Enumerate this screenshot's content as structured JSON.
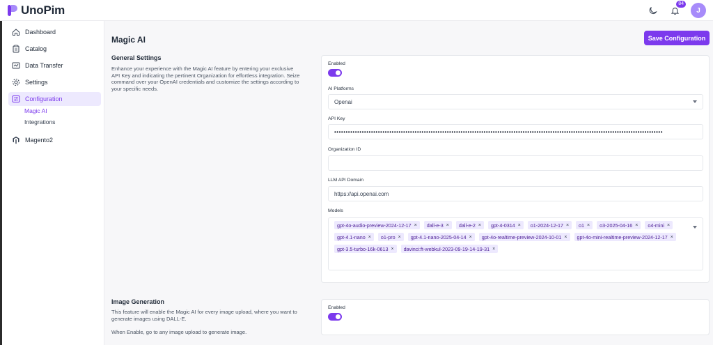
{
  "app": {
    "name": "UnoPim",
    "notifications_count": "84",
    "avatar_initial": "J",
    "accent_color": "#7c3aed"
  },
  "sidebar": {
    "items": [
      {
        "label": "Dashboard",
        "icon": "home-icon"
      },
      {
        "label": "Catalog",
        "icon": "clipboard-icon"
      },
      {
        "label": "Data Transfer",
        "icon": "data-transfer-icon"
      },
      {
        "label": "Settings",
        "icon": "gear-icon"
      },
      {
        "label": "Configuration",
        "icon": "sliders-icon"
      },
      {
        "label": "Magento2",
        "icon": "magento-icon"
      }
    ],
    "sub_items": [
      {
        "label": "Magic AI"
      },
      {
        "label": "Integrations"
      }
    ]
  },
  "page": {
    "title": "Magic AI",
    "save_label": "Save Configuration"
  },
  "general": {
    "title": "General Settings",
    "description": "Enhance your experience with the Magic AI feature by entering your exclusive API Key and indicating the pertinent Organization for effortless integration. Seize command over your OpenAI credentials and customize the settings according to your specific needs.",
    "enabled_label": "Enabled",
    "enabled": true,
    "platforms_label": "AI Platforms",
    "platform_value": "Openai",
    "api_key_label": "API Key",
    "api_key_value": "•••••••••••••••••••••••••••••••••••••••••••••••••••••••••••••••••••••••••••••••••••••••••••••••••••••••••••••••••••••••••••••••••••••••••••••••",
    "org_label": "Organization ID",
    "org_value": "",
    "domain_label": "LLM API Domain",
    "domain_value": "https://api.openai.com",
    "models_label": "Models",
    "models": [
      "gpt-4o-audio-preview-2024-12-17",
      "dall-e-3",
      "dall-e-2",
      "gpt-4-0314",
      "o1-2024-12-17",
      "o1",
      "o3-2025-04-16",
      "o4-mini",
      "gpt-4.1-nano",
      "o1-pro",
      "gpt-4.1-nano-2025-04-14",
      "gpt-4o-realtime-preview-2024-10-01",
      "gpt-4o-mini-realtime-preview-2024-12-17",
      "gpt-3.5-turbo-16k-0613",
      "davinci:ft-webkul-2023-09-19-14-19-31"
    ]
  },
  "image_generation": {
    "title": "Image Generation",
    "description": "This feature will enable the Magic AI for every image upload, where you want to generate images using DALL-E.",
    "note": "When Enable, go to any image upload to generate image.",
    "enabled_label": "Enabled",
    "enabled": true
  }
}
